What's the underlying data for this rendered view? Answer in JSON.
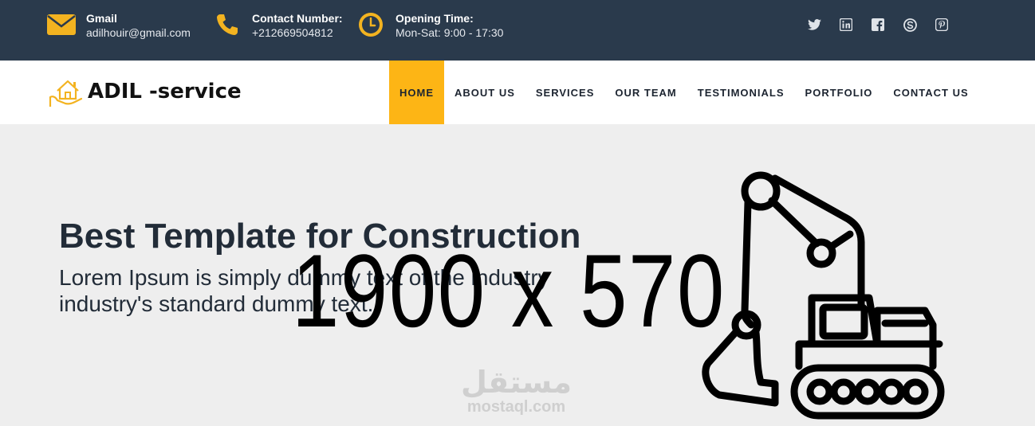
{
  "topbar": {
    "email": {
      "label": "Gmail",
      "value": "adilhouir@gmail.com",
      "icon": "envelope-icon"
    },
    "phone": {
      "label": "Contact Number:",
      "value": "+212669504812",
      "icon": "phone-icon"
    },
    "hours": {
      "label": "Opening Time:",
      "value": "Mon-Sat: 9:00 - 17:30",
      "icon": "clock-icon"
    },
    "social": [
      "twitter-icon",
      "linkedin-icon",
      "facebook-icon",
      "skype-icon",
      "pinterest-icon"
    ],
    "colors": {
      "background": "#2a3a4c",
      "accent": "#f3b320"
    }
  },
  "navbar": {
    "brand": "ADIL -service",
    "items": [
      "HOME",
      "ABOUT US",
      "SERVICES",
      "OUR TEAM",
      "TESTIMONIALS",
      "PORTFOLIO",
      "CONTACT US"
    ],
    "active": "HOME",
    "colors": {
      "active_bg": "#fdb515"
    }
  },
  "hero": {
    "title": "Best Template for Construction",
    "subtitle_line1": "Lorem Ipsum is simply dummy text of the industry",
    "subtitle_line2": "industry's standard dummy text.",
    "placeholder_size": "1900 x 570",
    "watermark_ar": "مستقل",
    "watermark_en": "mostaql.com",
    "colors": {
      "background": "#eeeeee"
    }
  }
}
